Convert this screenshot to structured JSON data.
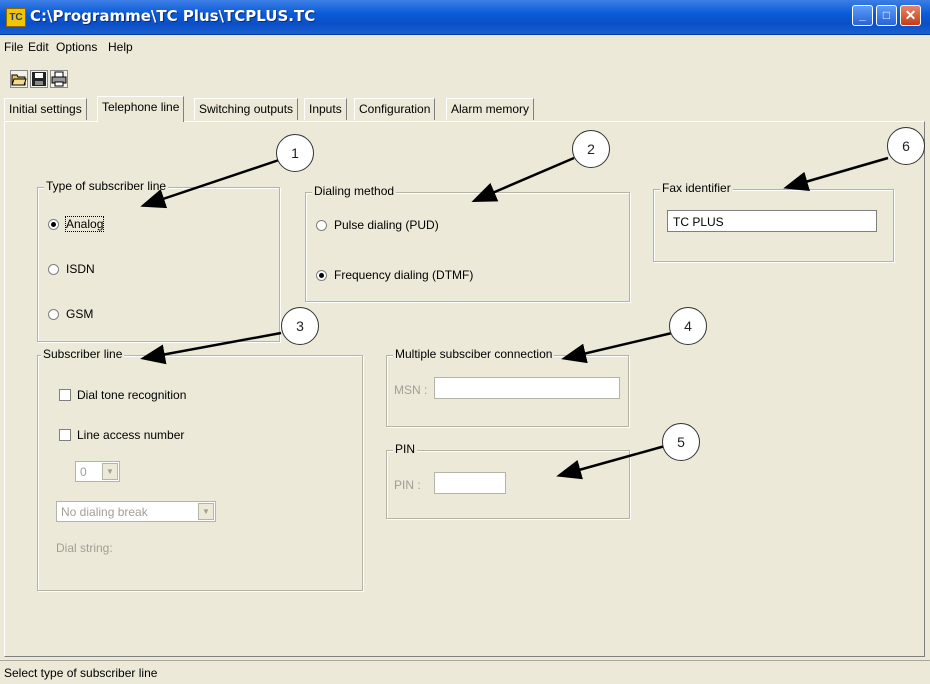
{
  "window": {
    "title": "C:\\Programme\\TC Plus\\TCPLUS.TC",
    "icon_text": "TC"
  },
  "menu": [
    "File",
    "Edit",
    "Options",
    "Help"
  ],
  "toolbar": {
    "icons": [
      "open-folder-icon",
      "save-icon",
      "print-icon"
    ]
  },
  "tabs": [
    "Initial settings",
    "Telephone line",
    "Switching outputs",
    "Inputs",
    "Configuration",
    "Alarm memory"
  ],
  "active_tab": "Telephone line",
  "subscriber_type": {
    "title": "Type of subscriber line",
    "options": [
      "Analog",
      "ISDN",
      "GSM"
    ],
    "selected": "Analog"
  },
  "dialing": {
    "title": "Dialing method",
    "options": [
      "Pulse dialing (PUD)",
      "Frequency dialing (DTMF)"
    ],
    "selected": "Frequency dialing (DTMF)"
  },
  "fax": {
    "title": "Fax identifier",
    "value": "TC PLUS"
  },
  "subscriber_line": {
    "title": "Subscriber line",
    "dial_tone": "Dial tone recognition",
    "line_access": "Line access number",
    "access_value": "0",
    "dial_break": "No dialing break",
    "dial_string": "Dial string:"
  },
  "msn": {
    "title": "Multiple subsciber connection",
    "label": "MSN :",
    "value": ""
  },
  "pin": {
    "title": "PIN",
    "label": "PIN :",
    "value": ""
  },
  "callouts": [
    "1",
    "2",
    "3",
    "4",
    "5",
    "6"
  ],
  "status": "Select type of subscriber line",
  "colors": {
    "titlebar": "#0a5bd8",
    "window_bg": "#ece9d8",
    "close_button": "#c33c18"
  }
}
